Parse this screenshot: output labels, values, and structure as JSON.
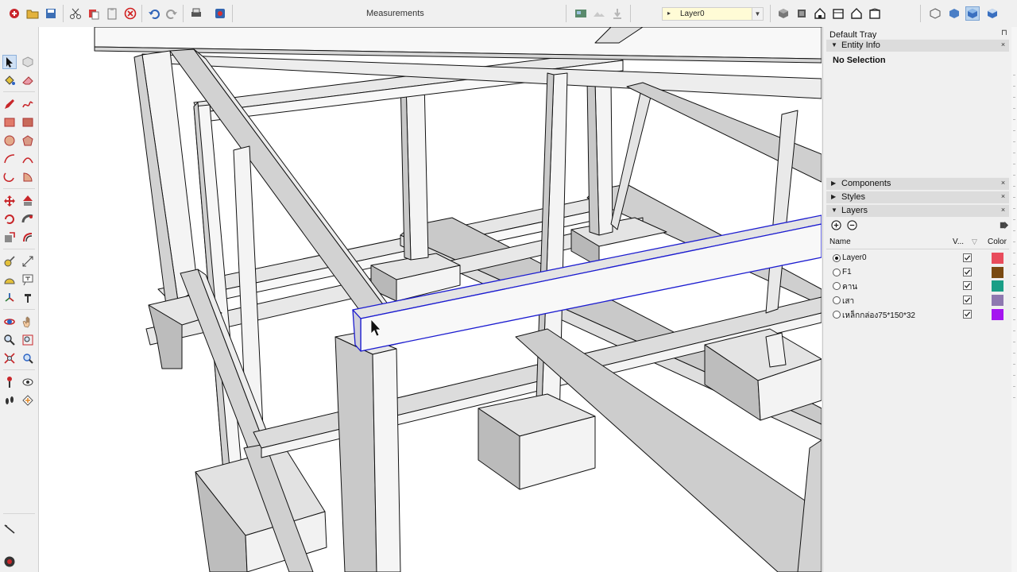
{
  "toolbar": {
    "measurements_label": "Measurements",
    "layer_selector_value": "Layer0",
    "icons": [
      "model-info-icon",
      "open-icon",
      "save-icon",
      "cut-icon",
      "copy-icon",
      "paste-icon",
      "erase-icon",
      "undo-icon",
      "redo-icon",
      "print-icon",
      "model-info-icon-2",
      "add-location-icon",
      "toggle-terrain-icon",
      "photo-texture-icon",
      "iso-view-icon",
      "top-view-icon",
      "front-view-icon",
      "right-view-icon",
      "back-view-icon",
      "left-view-icon",
      "xray-icon",
      "back-edges-icon",
      "wireframe-icon",
      "shaded-icon",
      "shaded-textures-icon"
    ]
  },
  "left_toolbar": {
    "icons": [
      "select-icon",
      "make-component-icon",
      "paint-bucket-icon",
      "eraser-icon",
      "pencil-icon",
      "freehand-icon",
      "rectangle-icon",
      "rotated-rectangle-icon",
      "circle-icon",
      "polygon-icon",
      "arc-icon",
      "two-point-arc-icon",
      "three-point-arc-icon",
      "pie-icon",
      "move-icon",
      "push-pull-icon",
      "rotate-icon",
      "follow-me-icon",
      "scale-icon",
      "offset-icon",
      "tape-measure-icon",
      "dimension-icon",
      "protractor-icon",
      "text-icon",
      "axes-icon",
      "3d-text-icon",
      "orbit-icon",
      "pan-icon",
      "zoom-icon",
      "zoom-window-icon",
      "zoom-extents-icon",
      "previous-view-icon",
      "position-camera-icon",
      "look-around-icon",
      "walk-icon",
      "section-plane-icon",
      "sandbox-icon",
      "warehouse-icon"
    ]
  },
  "tray": {
    "title": "Default Tray",
    "panels": {
      "entity_info": {
        "title": "Entity Info",
        "selection": "No Selection"
      },
      "components": {
        "title": "Components"
      },
      "styles": {
        "title": "Styles"
      },
      "layers": {
        "title": "Layers"
      }
    },
    "layers_table": {
      "col_name": "Name",
      "col_visible": "V...",
      "col_color": "Color",
      "rows": [
        {
          "name": "Layer0",
          "active": true,
          "visible": true,
          "color": "#e84c5c"
        },
        {
          "name": "F1",
          "active": false,
          "visible": true,
          "color": "#7a4a12"
        },
        {
          "name": "คาน",
          "active": false,
          "visible": true,
          "color": "#1a9e86"
        },
        {
          "name": "เสา",
          "active": false,
          "visible": true,
          "color": "#8e78b0"
        },
        {
          "name": "เหล็กกล่อง75*150*32",
          "active": false,
          "visible": true,
          "color": "#a515f0"
        }
      ]
    }
  },
  "viewport": {
    "description_free": true,
    "selection_color": "#1c1cd0"
  }
}
